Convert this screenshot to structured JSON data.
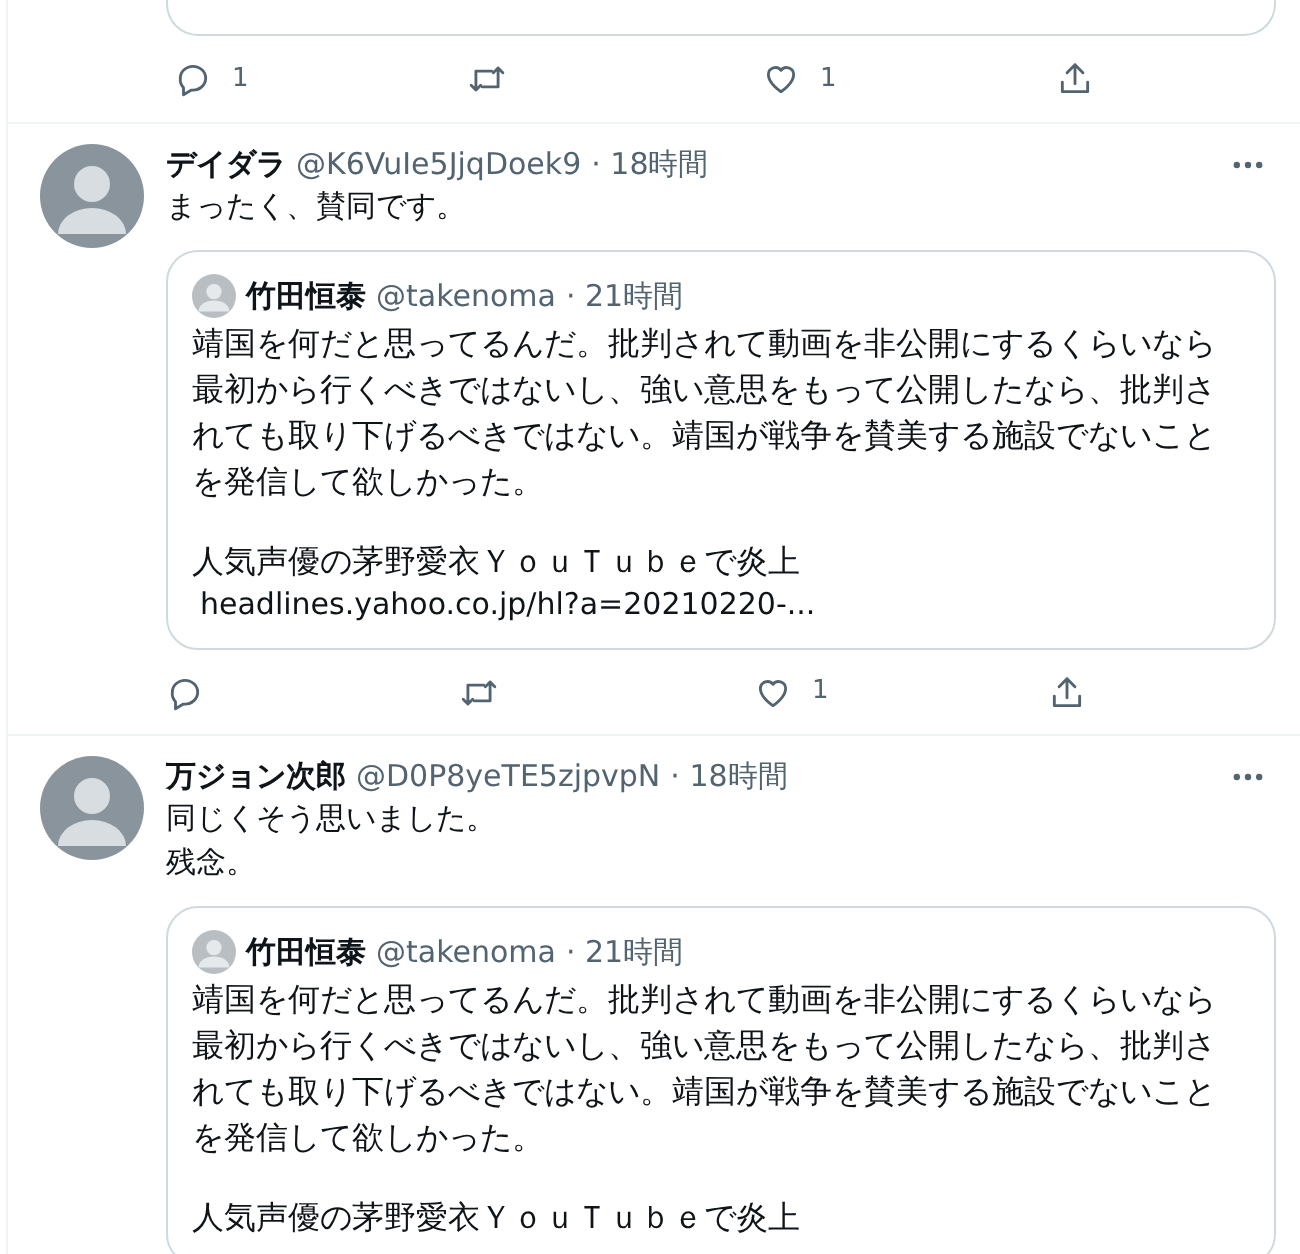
{
  "top_tweet": {
    "actions": [
      {
        "kind": "reply",
        "count": "1"
      },
      {
        "kind": "retweet"
      },
      {
        "kind": "like",
        "count": "1"
      },
      {
        "kind": "share"
      }
    ]
  },
  "tweets": [
    {
      "name": "デイダラ",
      "handle": "@K6VuIe5JjqDoek9",
      "time": "· 18時間",
      "lines": [
        "まったく、賛同です。"
      ],
      "quote": {
        "name": "竹田恒泰",
        "handle": "@takenoma",
        "time": "· 21時間",
        "text": "靖国を何だと思ってるんだ。批判されて動画を非公開にするくらいなら最初から行くべきではないし、強い意思をもって公開したなら、批判されても取り下げるべきではない。靖国が戦争を賛美する施設でないことを発信して欲しかった。",
        "headline": "人気声優の茅野愛衣ＹｏｕＴｕｂｅで炎上",
        "link": "headlines.yahoo.co.jp/hl?a=20210220-..."
      },
      "actions": [
        {
          "kind": "reply"
        },
        {
          "kind": "retweet"
        },
        {
          "kind": "like",
          "count": "1"
        },
        {
          "kind": "share"
        }
      ]
    },
    {
      "name": "万ジョン次郎",
      "handle": "@D0P8yeTE5zjpvpN",
      "time": "· 18時間",
      "lines": [
        "同じくそう思いました。",
        "残念。"
      ],
      "quote": {
        "name": "竹田恒泰",
        "handle": "@takenoma",
        "time": "· 21時間",
        "text": "靖国を何だと思ってるんだ。批判されて動画を非公開にするくらいなら最初から行くべきではないし、強い意思をもって公開したなら、批判されても取り下げるべきではない。靖国が戦争を賛美する施設でないことを発信して欲しかった。",
        "headline": "人気声優の茅野愛衣ＹｏｕＴｕｂｅで炎上"
      }
    }
  ]
}
